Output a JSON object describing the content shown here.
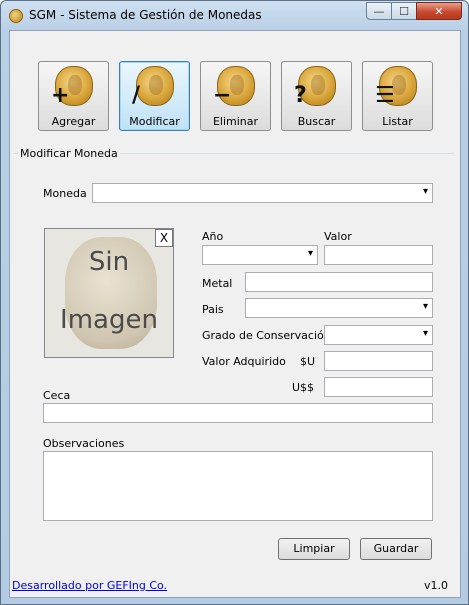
{
  "window": {
    "title": "SGM - Sistema de Gestión de Monedas",
    "min_glyph": "—",
    "max_glyph": "☐",
    "close_glyph": "✕"
  },
  "toolbar": {
    "buttons": [
      {
        "label": "Agregar",
        "glyph": "+",
        "icon": "plus-icon"
      },
      {
        "label": "Modificar",
        "glyph": "/",
        "icon": "pencil-icon"
      },
      {
        "label": "Eliminar",
        "glyph": "−",
        "icon": "minus-icon"
      },
      {
        "label": "Buscar",
        "glyph": "?",
        "icon": "question-icon"
      },
      {
        "label": "Listar",
        "glyph": "☰",
        "icon": "list-icon"
      }
    ],
    "selected": "Modificar"
  },
  "form": {
    "group_title": "Modificar Moneda",
    "moneda_label": "Moneda",
    "moneda_value": "",
    "anio_label": "Año",
    "valor_label": "Valor",
    "metal_label": "Metal",
    "pais_label": "Pais",
    "conservacion_label": "Grado de Conservación",
    "valor_adquirido_label": "Valor Adquirido",
    "currency_uy": "$U",
    "currency_us": "U$$",
    "ceca_label": "Ceca",
    "observaciones_label": "Observaciones",
    "image_placeholder_line1": "Sin",
    "image_placeholder_line2": "Imagen",
    "image_close": "X",
    "limpiar_label": "Limpiar",
    "guardar_label": "Guardar"
  },
  "footer": {
    "link_text": "Desarrollado por GEFIng Co.",
    "version": "v1.0"
  }
}
